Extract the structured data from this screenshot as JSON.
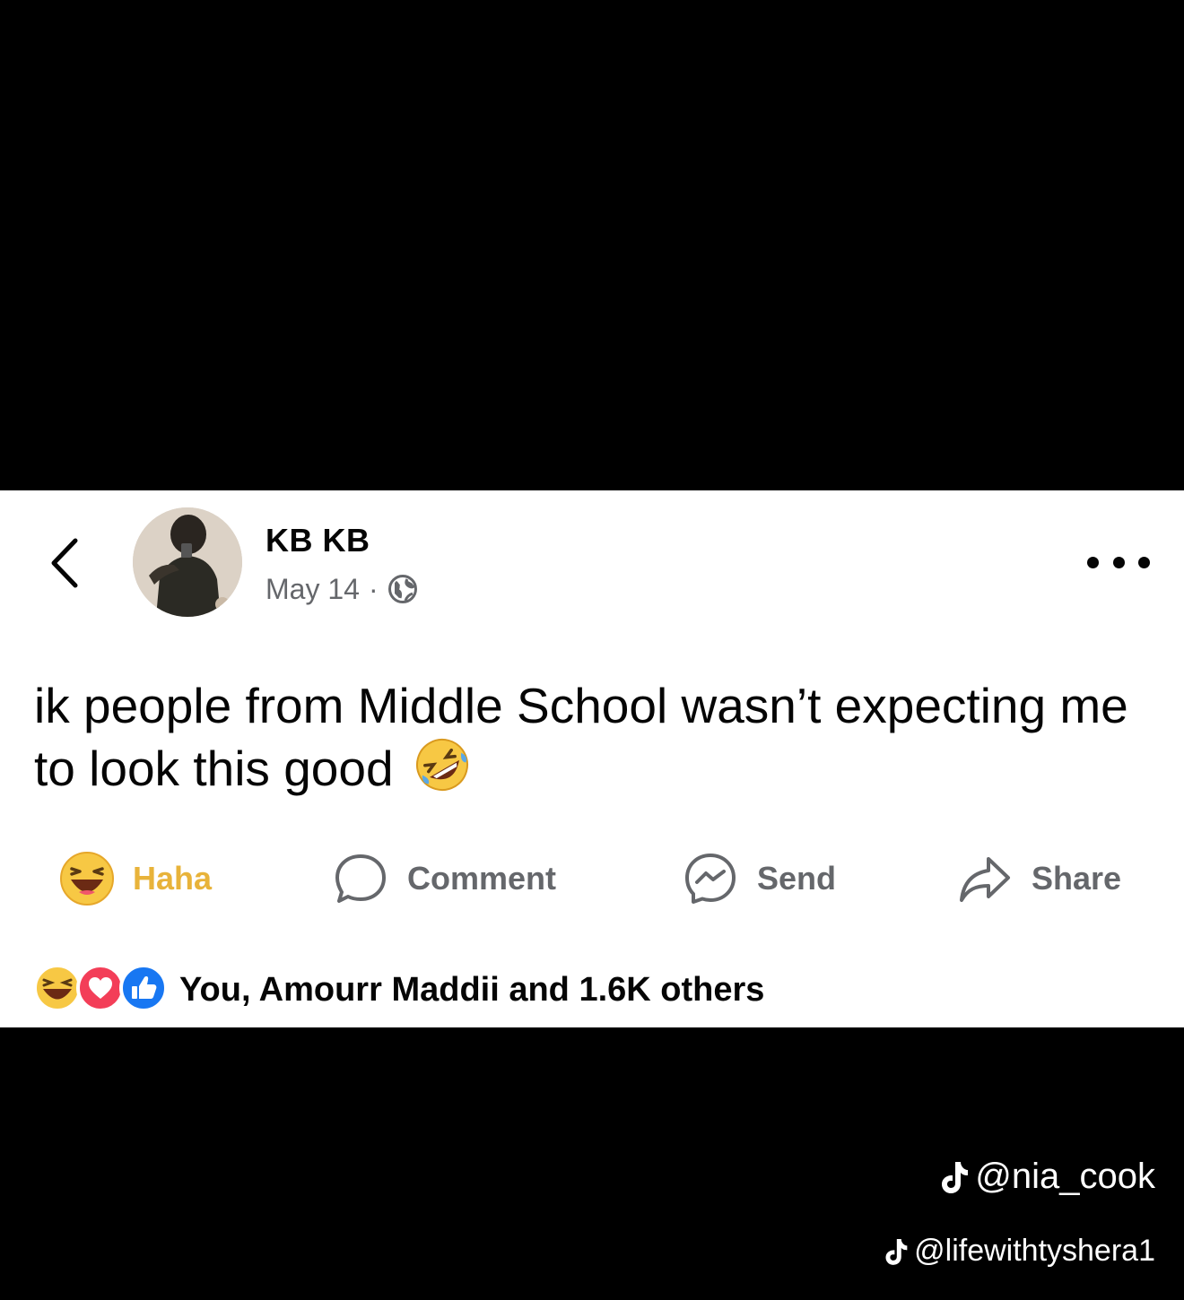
{
  "post": {
    "author": "KB KB",
    "date": "May 14",
    "separator": "·",
    "privacy_icon": "globe-icon",
    "text": "ik people from Middle School wasn’t expecting me to look this good",
    "text_emoji": "rolling-on-floor-laughing-emoji"
  },
  "actions": {
    "haha_label": "Haha",
    "comment_label": "Comment",
    "send_label": "Send",
    "share_label": "Share"
  },
  "reactions": {
    "icons": [
      "haha-icon",
      "love-icon",
      "like-icon"
    ],
    "summary": "You, Amourr Maddii and 1.6K others"
  },
  "watermarks": {
    "tiktok_primary": "@nia_cook",
    "tiktok_secondary": "@lifewithtyshera1"
  },
  "colors": {
    "background": "#000000",
    "card": "#ffffff",
    "haha_yellow": "#e8b33a",
    "love_red": "#f33e58",
    "like_blue": "#1877f2",
    "muted_text": "#65676b"
  }
}
